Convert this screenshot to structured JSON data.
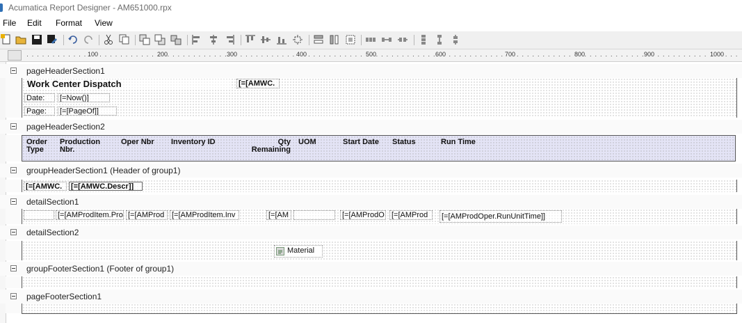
{
  "window": {
    "title": "Acumatica Report Designer - AM651000.rpx"
  },
  "menu": {
    "items": [
      "File",
      "Edit",
      "Format",
      "View"
    ]
  },
  "ruler": {
    "labels": [
      "100",
      "200",
      "300",
      "400",
      "500",
      "600",
      "700",
      "800",
      "900",
      "1000"
    ]
  },
  "sections": {
    "page_header_1": {
      "label": "pageHeaderSection1",
      "report_title": "Work Center Dispatch",
      "workcenter_field": "[=[AMWC.",
      "date_label": "Date:",
      "date_value": "[=Now()]",
      "page_label": "Page:",
      "page_value": "[=[PageOf]]"
    },
    "page_header_2": {
      "label": "pageHeaderSection2",
      "columns": [
        "Order\nType",
        "Production\nNbr.",
        "Oper Nbr",
        "Inventory ID",
        "Qty\nRemaining",
        "UOM",
        "Start Date",
        "Status",
        "Run Time"
      ]
    },
    "group_header_1": {
      "label": "groupHeaderSection1 (Header of group1)",
      "wc_id": "[=[AMWC.",
      "wc_descr": "[=[AMWC.Descr]]"
    },
    "detail_1": {
      "label": "detailSection1",
      "fields": [
        "[=[AMProdItem.Pro",
        "[=[AMProd",
        "[=[AMProdItem.Inv",
        "[=[AM",
        "[=[AMProdO",
        "[=[AMProd",
        "[=[AMProdOper.RunUnitTime]]"
      ]
    },
    "detail_2": {
      "label": "detailSection2",
      "subreport_label": "Material"
    },
    "group_footer_1": {
      "label": "groupFooterSection1 (Footer of group1)"
    },
    "page_footer_1": {
      "label": "pageFooterSection1"
    }
  },
  "colors": {
    "header_band": "#e4e4f6",
    "border": "#555555"
  }
}
